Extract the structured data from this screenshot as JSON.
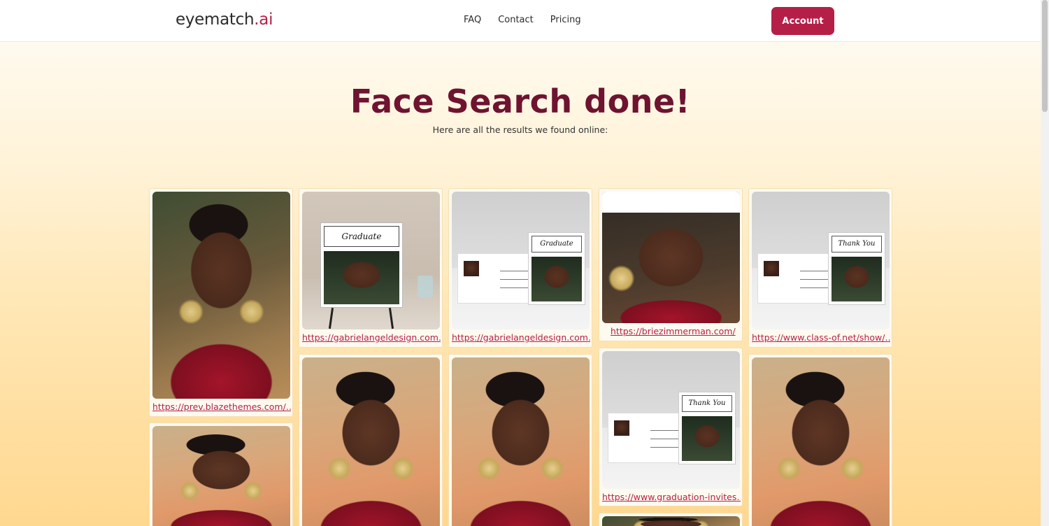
{
  "brand": {
    "logo_main": "eyematch",
    "logo_accent": ".ai"
  },
  "nav": {
    "items": [
      "FAQ",
      "Contact",
      "Pricing"
    ],
    "account_label": "Account"
  },
  "hero": {
    "title": "Face Search done!",
    "subtitle": "Here are all the results we found online:"
  },
  "results": [
    {
      "link": "https://prev.blazethemes.com/…",
      "image": "portrait-seated"
    },
    {
      "link": "https://gabrielangeldesign.com…",
      "image": "graduate-easel-sign"
    },
    {
      "link": "https://gabrielangeldesign.com…",
      "image": "graduate-postcard-mockup"
    },
    {
      "link": "https://briezimmerman.com/",
      "image": "close-up-portrait"
    },
    {
      "link": "https://www.class-of.net/show/…",
      "image": "thank-you-postcard-mockup"
    },
    {
      "link": "https://www.graduation-invites…",
      "image": "thank-you-postcard-mockup"
    },
    {
      "link": "",
      "image": "portrait-warm"
    },
    {
      "link": "",
      "image": "portrait-warm"
    },
    {
      "link": "",
      "image": "portrait-warm"
    },
    {
      "link": "",
      "image": "portrait-warm"
    },
    {
      "link": "",
      "image": "portrait-partial"
    }
  ],
  "mockup_text": {
    "graduate": "Graduate",
    "thank_you": "Thank You"
  },
  "colors": {
    "accent": "#b51f47",
    "title": "#6e1330"
  }
}
